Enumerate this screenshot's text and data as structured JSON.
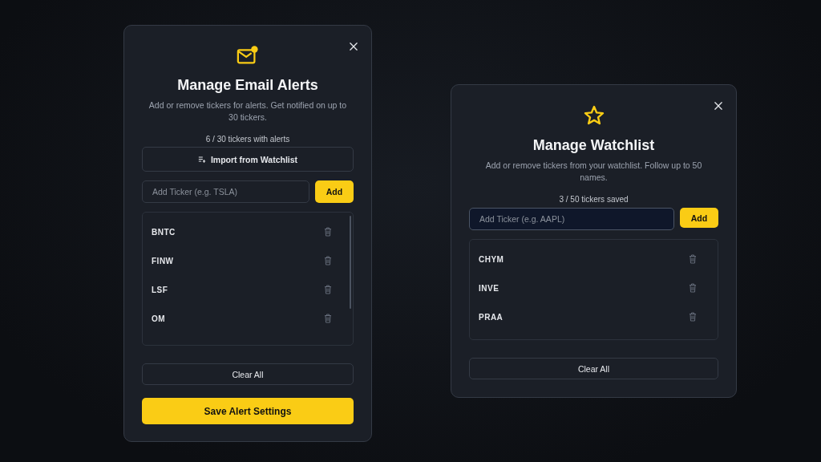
{
  "modals": [
    {
      "kind": "mail",
      "title": "Manage Email Alerts",
      "description": "Add or remove tickers for alerts. Get notified on up to 30 tickers.",
      "count": "6 / 30 tickers with alerts",
      "import_button": "Import from Watchlist",
      "input": {
        "placeholder": "Add Ticker (e.g. TSLA)",
        "focused": false
      },
      "add_button": "Add",
      "tickers": [
        "BNTC",
        "FINW",
        "LSF",
        "OM"
      ],
      "clear_button": "Clear All",
      "save_button": "Save Alert Settings"
    },
    {
      "kind": "star",
      "title": "Manage Watchlist",
      "description": "Add or remove tickers from your watchlist. Follow up to 50 names.",
      "count": "3 / 50 tickers saved",
      "input": {
        "placeholder": "Add Ticker (e.g. AAPL)",
        "focused": true
      },
      "add_button": "Add",
      "tickers": [
        "CHYM",
        "INVE",
        "PRAA"
      ],
      "clear_button": "Clear All"
    }
  ]
}
